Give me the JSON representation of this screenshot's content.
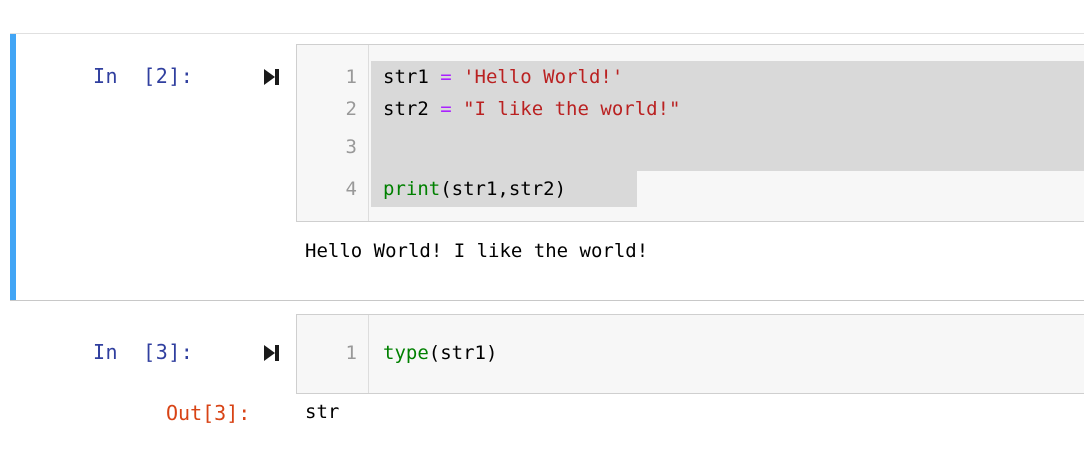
{
  "cells": [
    {
      "prompt": "In  [2]:",
      "lines": [
        {
          "num": "1",
          "tokens": [
            {
              "t": "str1 ",
              "c": "var"
            },
            {
              "t": "=",
              "c": "op"
            },
            {
              "t": " ",
              "c": "var"
            },
            {
              "t": "'Hello World!'",
              "c": "str"
            }
          ]
        },
        {
          "num": "2",
          "tokens": [
            {
              "t": "str2 ",
              "c": "var"
            },
            {
              "t": "=",
              "c": "op"
            },
            {
              "t": " ",
              "c": "var"
            },
            {
              "t": "\"I like the world!\"",
              "c": "str"
            }
          ]
        },
        {
          "num": "3",
          "tokens": []
        },
        {
          "num": "4",
          "tokens": [
            {
              "t": "print",
              "c": "builtin"
            },
            {
              "t": "(str1,str2)",
              "c": "punc"
            }
          ]
        }
      ],
      "output": "Hello World! I like the world!"
    },
    {
      "prompt": "In  [3]:",
      "lines": [
        {
          "num": "1",
          "tokens": [
            {
              "t": "type",
              "c": "builtin"
            },
            {
              "t": "(str1)",
              "c": "punc"
            }
          ]
        }
      ],
      "out_prompt": "Out[3]:",
      "output": "str"
    }
  ],
  "colors": {
    "selected_bar": "#42a5f5",
    "in_prompt": "#303f9f",
    "out_prompt": "#d84315",
    "string": "#ba2121",
    "builtin": "#008000",
    "operator": "#aa22ff"
  },
  "icons": {
    "run": "run-cell-icon"
  }
}
